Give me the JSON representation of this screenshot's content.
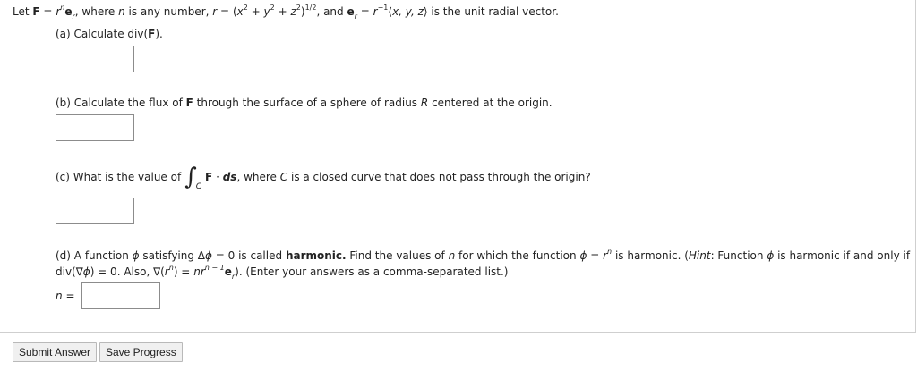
{
  "problem": {
    "intro": {
      "let": "Let",
      "F": "F",
      "eq": "=",
      "r": "r",
      "n": "n",
      "e": "e",
      "r_sub": "r",
      "where": ", where",
      "n2": "n",
      "is_any_number": "is any number,",
      "r2": "r",
      "eq2": "=",
      "paren_open": "(",
      "x": "x",
      "two1": "2",
      "plus1": "+",
      "y": "y",
      "two2": "2",
      "plus2": "+",
      "z": "z",
      "two3": "2",
      "paren_close": ")",
      "half": "1/2",
      "and": ", and",
      "e2": "e",
      "r_sub2": "r",
      "eq3": "=",
      "r3": "r",
      "minus_one": "−1",
      "angle_open": "⟨",
      "xyz": "x, y, z",
      "angle_close": "⟩",
      "tail": "is the unit radial vector."
    },
    "part_a": {
      "prefix": "(a) Calculate div(",
      "F": "F",
      "suffix": ")."
    },
    "part_b": {
      "prefix": "(b) Calculate the flux of",
      "F": "F",
      "mid": "through the surface of a sphere of radius",
      "R": "R",
      "suffix": "centered at the origin."
    },
    "part_c": {
      "prefix": "(c) What is the value of",
      "integral": "∫",
      "sub": "C",
      "F": "F",
      "dot": "·",
      "ds": "ds",
      "where": ", where",
      "C": "C",
      "suffix": "is a closed curve that does not pass through the origin?"
    },
    "part_d": {
      "line1_a": "(d) A function",
      "phi1": "ϕ",
      "line1_b": "satisfying Δ",
      "phi2": "ϕ",
      "line1_c": "= 0 is called",
      "harmonic": "harmonic.",
      "line1_d": "Find the values of",
      "n1": "n",
      "line1_e": "for which the function",
      "phi3": "ϕ",
      "line1_f": "=",
      "r1": "r",
      "n_sup": "n",
      "line1_g": "is harmonic. (",
      "hint": "Hint",
      "line1_h": ": Function",
      "phi4": "ϕ",
      "line1_i": "is harmonic if and only if",
      "line2_a": "div(∇",
      "phi5": "ϕ",
      "line2_b": ") = 0. Also, ∇(",
      "r2": "r",
      "n2": "n",
      "line2_c": ") =",
      "n3": "n",
      "r3": "r",
      "exp": "n − 1",
      "e": "e",
      "e_sub": "r",
      "line2_d": "). (Enter your answers as a comma-separated list.)",
      "n_label": "n",
      "n_eq": "="
    }
  },
  "buttons": {
    "submit": "Submit Answer",
    "save": "Save Progress"
  }
}
